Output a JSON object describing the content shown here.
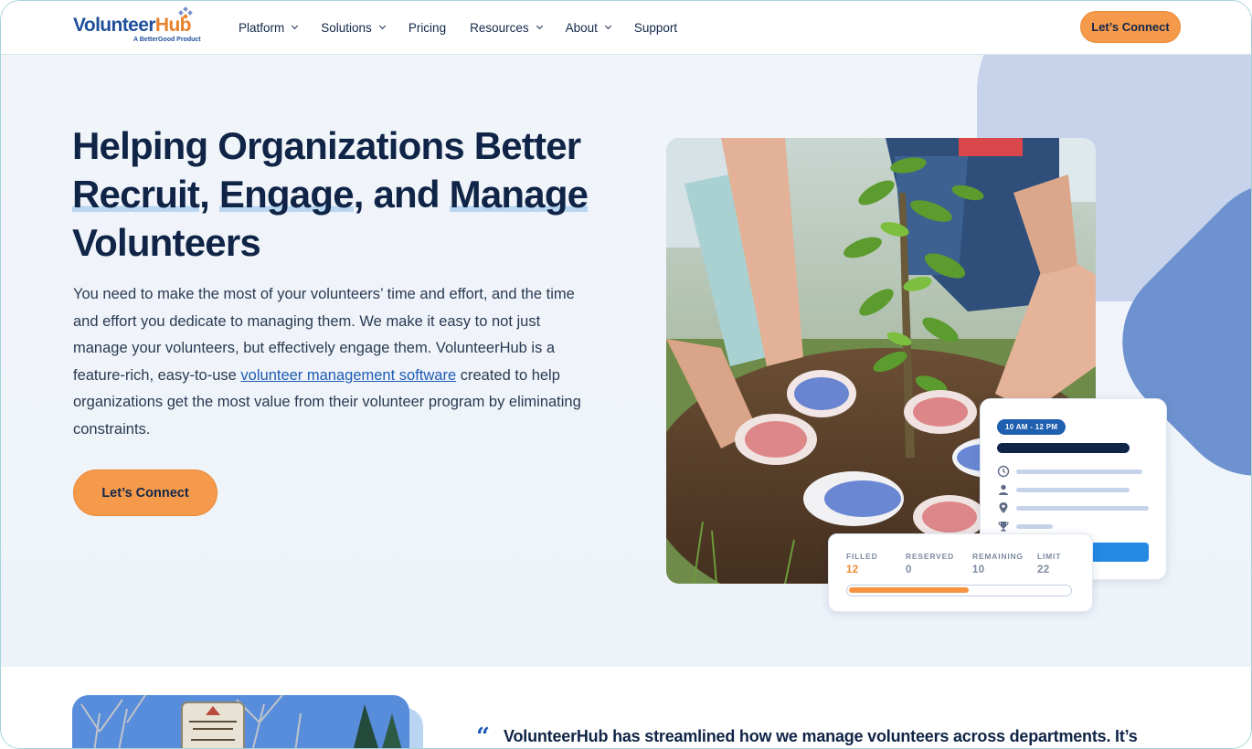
{
  "brand": {
    "name_part1": "Volunteer",
    "name_part2": "Hub",
    "tagline": "A BetterGood Product",
    "colors": {
      "navy": "#0f2446",
      "orange": "#f59a4a",
      "blue": "#1f5bb4",
      "light_blue": "#c6d3ea"
    }
  },
  "nav": {
    "items": [
      {
        "label": "Platform",
        "dropdown": true
      },
      {
        "label": "Solutions",
        "dropdown": true
      },
      {
        "label": "Pricing",
        "dropdown": false
      },
      {
        "label": "Resources",
        "dropdown": true
      },
      {
        "label": "About",
        "dropdown": true
      },
      {
        "label": "Support",
        "dropdown": false
      }
    ],
    "cta": "Let’s Connect"
  },
  "hero": {
    "title_line1": "Helping Organizations Better",
    "title_recruit": "Recruit",
    "title_comma": ",",
    "title_engage": "Engage",
    "title_and": ", and",
    "title_manage": "Manage",
    "title_line3": "Volunteers",
    "body_part1": "You need to make the most of your volunteers’ time and effort, and the time and effort you dedicate to managing them. We make it easy to not just manage your volunteers, but effectively engage them. VolunteerHub is a feature-rich, easy-to-use",
    "body_link": "volunteer management software",
    "body_part2": "created to help organizations get the most value from their volunteer program by eliminating constraints.",
    "cta": "Let’s Connect",
    "photo_icon": "volunteers-planting-tree-photo"
  },
  "event_card": {
    "time": "10 AM - 12 PM",
    "icons": [
      "clock-icon",
      "person-icon",
      "location-pin-icon",
      "trophy-icon"
    ]
  },
  "stats_card": {
    "items": [
      {
        "label": "FILLED",
        "value": "12"
      },
      {
        "label": "RESERVED",
        "value": "0"
      },
      {
        "label": "REMAINING",
        "value": "10"
      },
      {
        "label": "LIMIT",
        "value": "22"
      }
    ],
    "progress_fraction": 0.545
  },
  "testimonial": {
    "quote_mark": "“",
    "text": "VolunteerHub has streamlined how we manage volunteers across departments. It’s"
  }
}
